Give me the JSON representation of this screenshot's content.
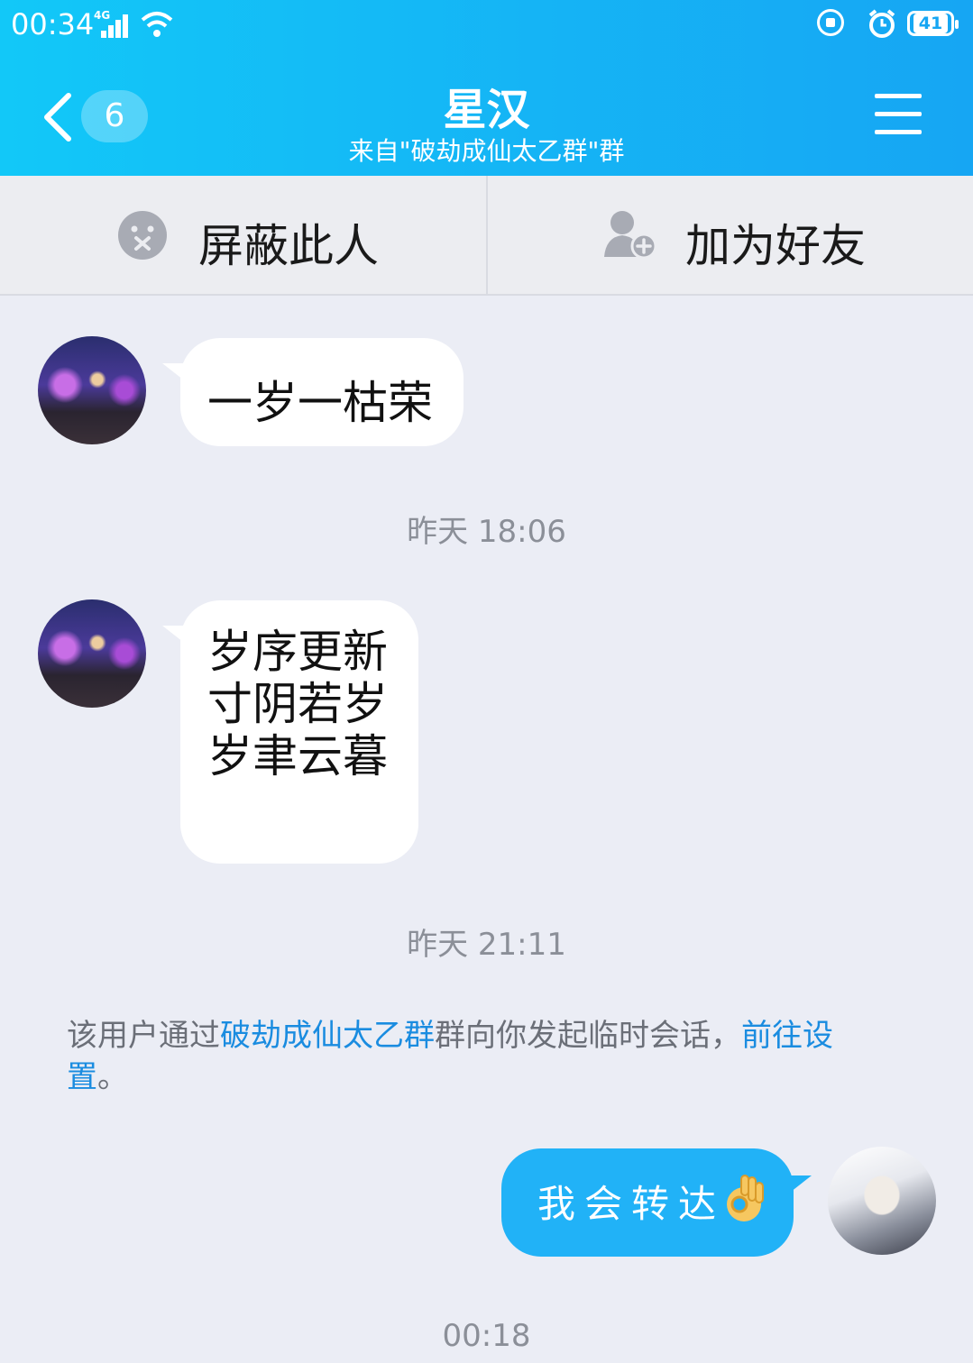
{
  "status_bar": {
    "time": "00:34",
    "network": "4G",
    "battery": "41"
  },
  "header": {
    "back_badge": "6",
    "title": "星汉",
    "subtitle": "来自\"破劫成仙太乙群\"群"
  },
  "actions": {
    "block_label": "屏蔽此人",
    "add_friend_label": "加为好友"
  },
  "messages": [
    {
      "sender": "other",
      "text": "一岁一枯荣"
    },
    {
      "timestamp": "昨天 18:06"
    },
    {
      "sender": "other",
      "lines": [
        "岁序更新",
        "寸阴若岁",
        "岁聿云暮"
      ]
    },
    {
      "timestamp": "昨天 21:11"
    },
    {
      "sender": "me",
      "text": "我会转达"
    },
    {
      "timestamp": "00:18"
    }
  ],
  "notice": {
    "prefix": "该用户通过",
    "group_link": "破劫成仙太乙群",
    "middle": "群向你发起临时会话，",
    "settings_link_1": "前往设",
    "settings_link_2": "置",
    "suffix": "。"
  },
  "colors": {
    "header_start": "#12c8f8",
    "header_end": "#16a6f3",
    "my_bubble": "#21b2f7",
    "link": "#1a8ce0"
  }
}
